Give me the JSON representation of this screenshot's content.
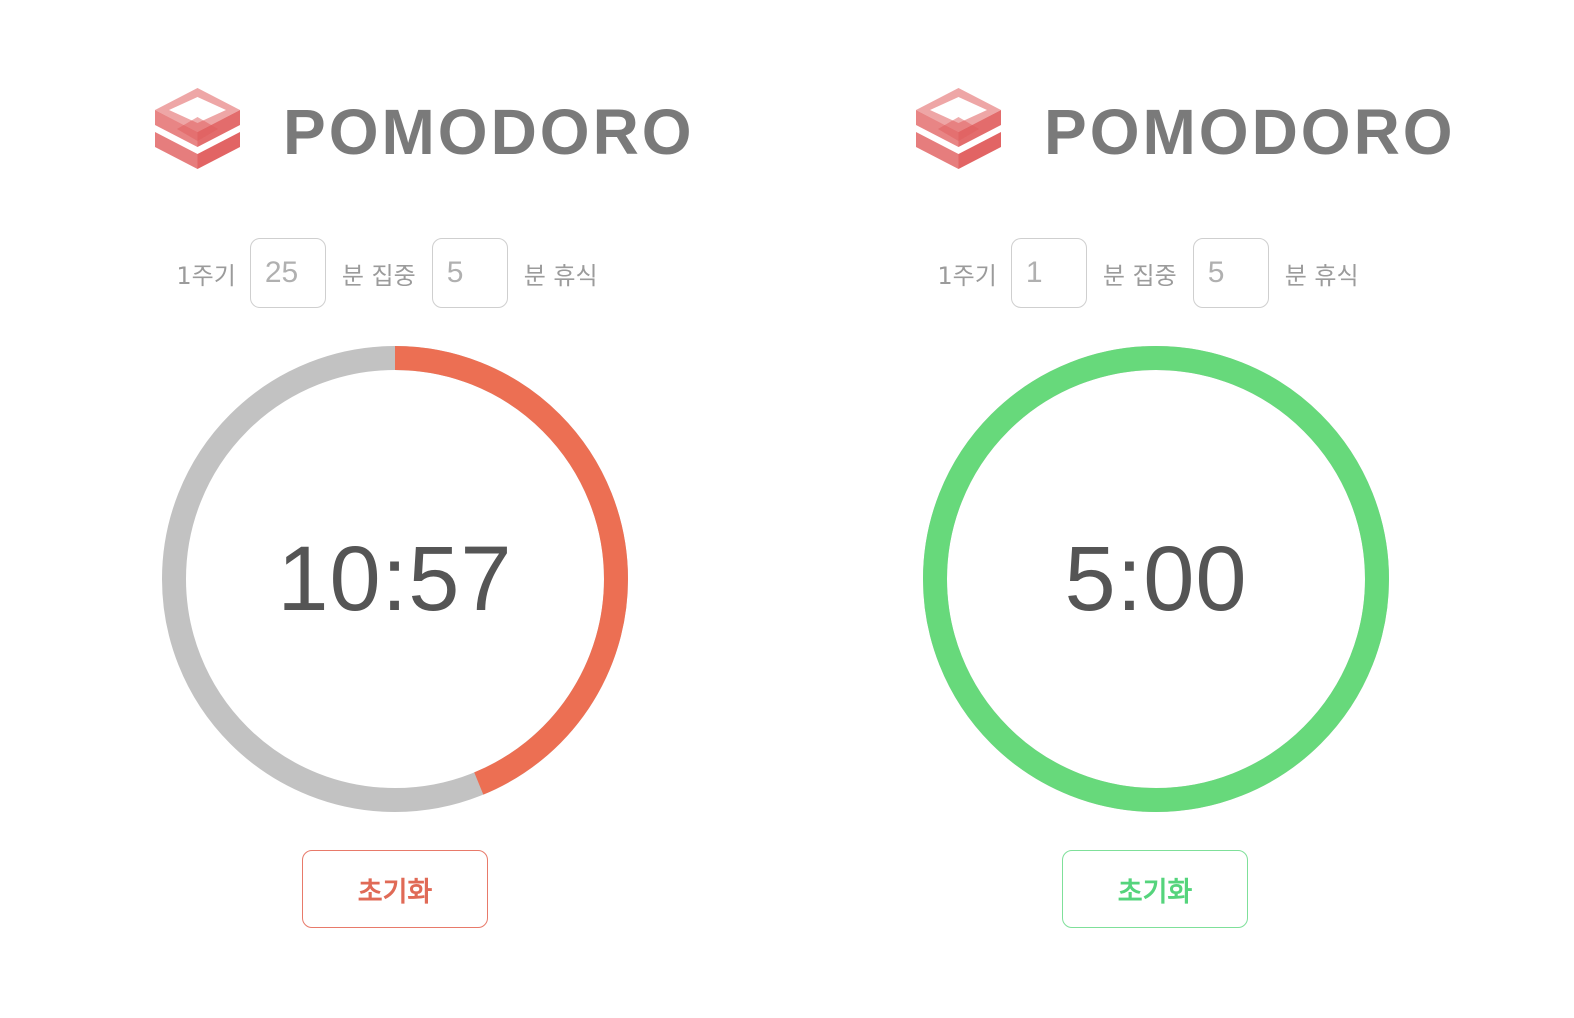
{
  "colors": {
    "focus_accent": "#ec6f53",
    "break_accent": "#67d97b",
    "track": "#c2c2c2",
    "logo": "#e06060"
  },
  "panels": [
    {
      "mode": "focus",
      "brand": "POMODORO",
      "logo_icon": "stacked-cube-logo-icon",
      "cycle_label": "1주기",
      "focus_minutes": "25",
      "focus_unit_label": "분 집중",
      "break_minutes": "5",
      "break_unit_label": "분 휴식",
      "time": "10:57",
      "progress": 0.438,
      "reset_label": "초기화"
    },
    {
      "mode": "break",
      "brand": "POMODORO",
      "logo_icon": "stacked-cube-logo-icon",
      "cycle_label": "1주기",
      "focus_minutes": "1",
      "focus_unit_label": "분 집중",
      "break_minutes": "5",
      "break_unit_label": "분 휴식",
      "time": "5:00",
      "progress": 1.0,
      "reset_label": "초기화"
    }
  ]
}
